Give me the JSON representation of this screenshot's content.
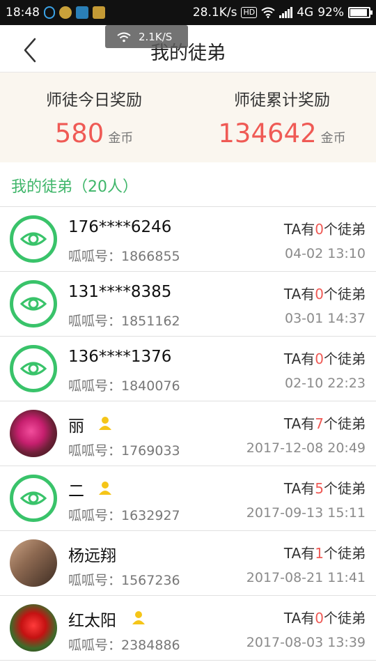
{
  "status_bar": {
    "time": "18:48",
    "net_speed": "28.1K/s",
    "hd_badge": "HD",
    "network": "4G",
    "battery": "92%",
    "battery_level": 0.92,
    "icons": [
      "headset-icon",
      "app-icon",
      "scan-icon",
      "app-icon"
    ]
  },
  "speed_toast": {
    "text": "2.1K/S"
  },
  "header": {
    "title": "我的徒弟"
  },
  "rewards": {
    "today_label": "师徒今日奖励",
    "today_value": "580",
    "today_unit": "金币",
    "total_label": "师徒累计奖励",
    "total_value": "134642",
    "total_unit": "金币"
  },
  "section": {
    "title": "我的徒弟（20人）"
  },
  "disciples": [
    {
      "name": "176****6246",
      "account": "呱呱号：1866855",
      "prefix": "TA有",
      "count": "0",
      "suffix": "个徒弟",
      "time": "04-02 13:10"
    },
    {
      "name": "131****8385",
      "account": "呱呱号：1851162",
      "prefix": "TA有",
      "count": "0",
      "suffix": "个徒弟",
      "time": "03-01 14:37"
    },
    {
      "name": "136****1376",
      "account": "呱呱号：1840076",
      "prefix": "TA有",
      "count": "0",
      "suffix": "个徒弟",
      "time": "02-10 22:23"
    },
    {
      "name": "丽",
      "account": "呱呱号：1769033",
      "prefix": "TA有",
      "count": "7",
      "suffix": "个徒弟",
      "time": "2017-12-08 20:49"
    },
    {
      "name": "二",
      "account": "呱呱号：1632927",
      "prefix": "TA有",
      "count": "5",
      "suffix": "个徒弟",
      "time": "2017-09-13 15:11"
    },
    {
      "name": "杨远翔",
      "account": "呱呱号：1567236",
      "prefix": "TA有",
      "count": "1",
      "suffix": "个徒弟",
      "time": "2017-08-21 11:41"
    },
    {
      "name": "红太阳",
      "account": "呱呱号：2384886",
      "prefix": "TA有",
      "count": "0",
      "suffix": "个徒弟",
      "time": "2017-08-03 13:39"
    }
  ],
  "colors": {
    "accent_green": "#3fb66a",
    "count_red": "#ef5a55",
    "reward_bg": "#faf6ef"
  }
}
